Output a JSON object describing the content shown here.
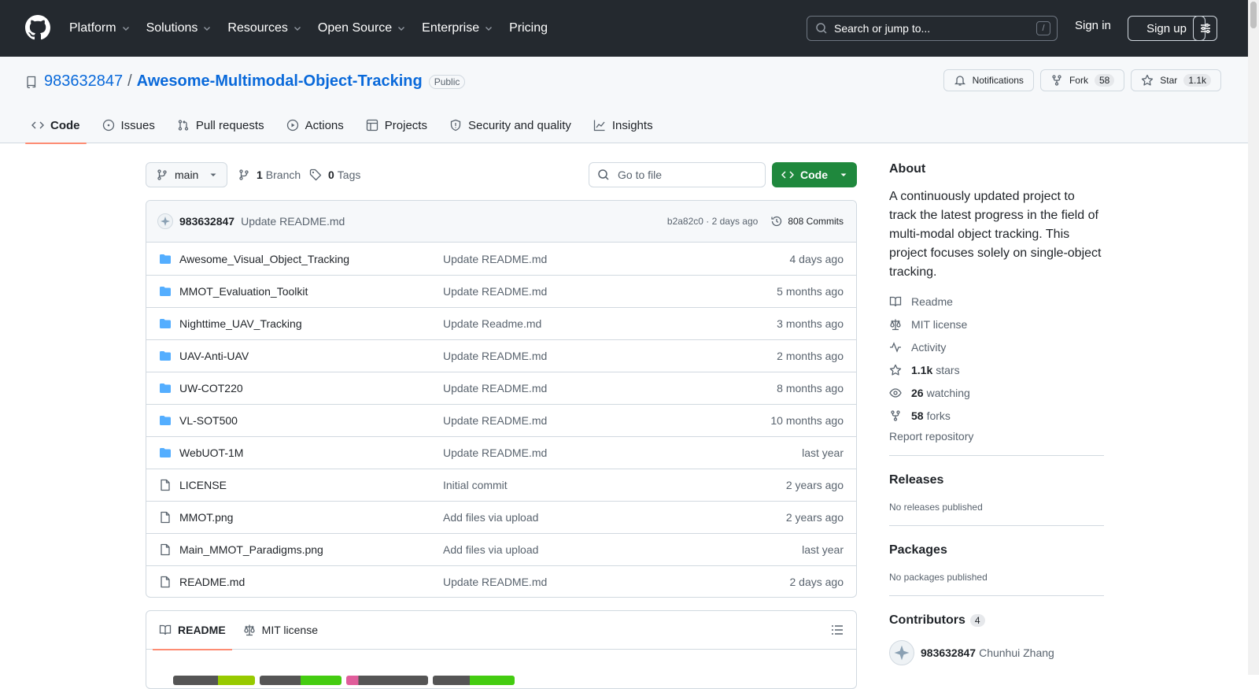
{
  "header": {
    "nav": [
      "Platform",
      "Solutions",
      "Resources",
      "Open Source",
      "Enterprise",
      "Pricing"
    ],
    "search_placeholder": "Search or jump to...",
    "search_shortcut": "/",
    "sign_in": "Sign in",
    "sign_up": "Sign up"
  },
  "repo": {
    "owner": "983632847",
    "separator": "/",
    "name": "Awesome-Multimodal-Object-Tracking",
    "visibility": "Public",
    "notifications_label": "Notifications",
    "fork_label": "Fork",
    "fork_count": "58",
    "star_label": "Star",
    "star_count": "1.1k",
    "tabs": [
      "Code",
      "Issues",
      "Pull requests",
      "Actions",
      "Projects",
      "Security and quality",
      "Insights"
    ]
  },
  "toolbar": {
    "branch": "main",
    "branch_count": "1",
    "branch_label": "Branch",
    "tag_count": "0",
    "tag_label": "Tags",
    "goto_placeholder": "Go to file",
    "code_label": "Code"
  },
  "latest_commit": {
    "author": "983632847",
    "message": "Update README.md",
    "hash_time": "b2a82c0 · 2 days ago",
    "commits": "808 Commits"
  },
  "files": [
    {
      "type": "dir",
      "name": "Awesome_Visual_Object_Tracking",
      "message": "Update README.md",
      "date": "4 days ago"
    },
    {
      "type": "dir",
      "name": "MMOT_Evaluation_Toolkit",
      "message": "Update README.md",
      "date": "5 months ago"
    },
    {
      "type": "dir",
      "name": "Nighttime_UAV_Tracking",
      "message": "Update Readme.md",
      "date": "3 months ago"
    },
    {
      "type": "dir",
      "name": "UAV-Anti-UAV",
      "message": "Update README.md",
      "date": "2 months ago"
    },
    {
      "type": "dir",
      "name": "UW-COT220",
      "message": "Update README.md",
      "date": "8 months ago"
    },
    {
      "type": "dir",
      "name": "VL-SOT500",
      "message": "Update README.md",
      "date": "10 months ago"
    },
    {
      "type": "dir",
      "name": "WebUOT-1M",
      "message": "Update README.md",
      "date": "last year"
    },
    {
      "type": "file",
      "name": "LICENSE",
      "message": "Initial commit",
      "date": "2 years ago"
    },
    {
      "type": "file",
      "name": "MMOT.png",
      "message": "Add files via upload",
      "date": "2 years ago"
    },
    {
      "type": "file",
      "name": "Main_MMOT_Paradigms.png",
      "message": "Add files via upload",
      "date": "last year"
    },
    {
      "type": "file",
      "name": "README.md",
      "message": "Update README.md",
      "date": "2 days ago"
    }
  ],
  "readme": {
    "tab_readme": "README",
    "tab_license": "MIT license"
  },
  "about": {
    "heading": "About",
    "description": "A continuously updated project to track the latest progress in the field of multi-modal object tracking. This project focuses solely on single-object tracking.",
    "readme": "Readme",
    "license": "MIT license",
    "activity": "Activity",
    "stars_count": "1.1k",
    "stars_label": "stars",
    "watching_count": "26",
    "watching_label": "watching",
    "forks_count": "58",
    "forks_label": "forks",
    "report": "Report repository"
  },
  "releases": {
    "heading": "Releases",
    "empty": "No releases published"
  },
  "packages": {
    "heading": "Packages",
    "empty": "No packages published"
  },
  "contributors": {
    "heading": "Contributors",
    "count": "4",
    "first_login": "983632847",
    "first_name": "Chunhui Zhang"
  },
  "icons": {
    "folder_color": "#54aeff",
    "accent_green": "#1f883d",
    "link_blue": "#0969da"
  }
}
